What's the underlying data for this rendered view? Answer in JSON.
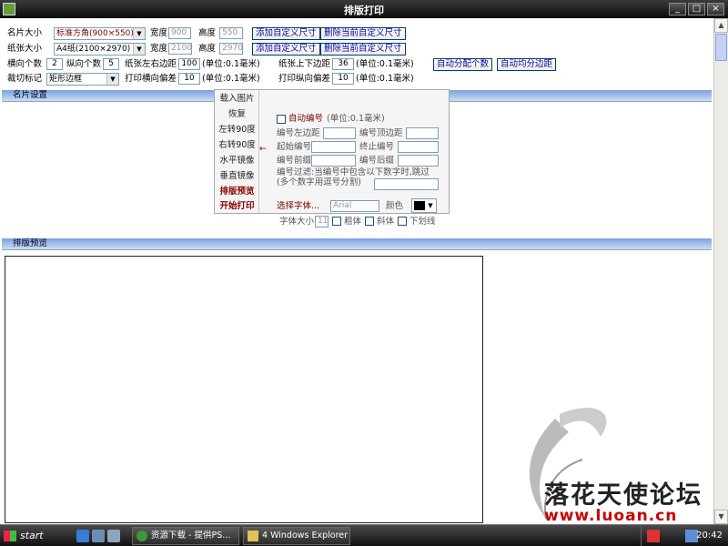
{
  "window": {
    "title": "排版打印",
    "min": "_",
    "max": "□",
    "close": "×"
  },
  "scroll": {
    "up": "▲",
    "down": "▼"
  },
  "row1": {
    "card_size_label": "名片大小",
    "card_size_value": "标准方角(900×550)",
    "width_label": "宽度",
    "width_value": "900",
    "height_label": "高度",
    "height_value": "550",
    "add_custom": "添加自定义尺寸",
    "remove_custom": "删除当前自定义尺寸"
  },
  "row2": {
    "paper_size_label": "纸张大小",
    "paper_size_value": "A4纸(2100×2970)",
    "width_label": "宽度",
    "width_value": "2100",
    "height_label": "高度",
    "height_value": "2970",
    "add_custom": "添加自定义尺寸",
    "remove_custom": "删除当前自定义尺寸"
  },
  "row3": {
    "h_count_label": "横向个数",
    "h_count_value": "2",
    "v_count_label": "纵向个数",
    "v_count_value": "5",
    "lr_margin_label": "纸张左右边距",
    "lr_margin_value": "100",
    "unit1": "(单位:0.1毫米)",
    "tb_margin_label": "纸张上下边距",
    "tb_margin_value": "36",
    "unit2": "(单位:0.1毫米)",
    "auto_count": "自动分配个数",
    "auto_margin": "自动均分边距"
  },
  "row4": {
    "crop_label": "裁切标记",
    "crop_value": "矩形边框",
    "h_offset_label": "打印横向偏差",
    "h_offset_value": "10",
    "unit1": "(单位:0.1毫米)",
    "v_offset_label": "打印纵向偏差",
    "v_offset_value": "10",
    "unit2": "(单位:0.1毫米)"
  },
  "sections": {
    "card_settings": "名片设置",
    "preview": "排版预览"
  },
  "menu": {
    "load_image": "载入图片",
    "restore": "恢复",
    "rotate_left": "左转90度",
    "rotate_right": "右转90度",
    "flip_h": "水平镜像",
    "flip_v": "垂直镜像",
    "layout_preview": "排版预览",
    "start_print": "开始打印",
    "arrow": "←"
  },
  "numbering": {
    "auto_label": "自动编号",
    "unit": "(单位:0.1毫米)",
    "left_margin_label": "编号左边距",
    "top_margin_label": "编号顶边距",
    "start_label": "起始编号",
    "end_label": "终止编号",
    "prefix_label": "编号前缀",
    "suffix_label": "编号后缀",
    "filter_line1": "编号过滤:当编号中包含以下数字时,跳过",
    "filter_line2": "(多个数字用逗号分割)"
  },
  "font": {
    "choose_label": "选择字体...",
    "font_value": "Arial",
    "color_label": "颜色",
    "size_label": "字体大小",
    "size_value": "11",
    "bold_label": "粗体",
    "italic_label": "斜体",
    "underline_label": "下划线"
  },
  "watermark": {
    "text_cn": "落花天使论坛",
    "url": "www.luoan.cn"
  },
  "taskbar": {
    "start": "start",
    "task1": "资源下载 - 提供PS...",
    "task2": "4 Windows Explorer",
    "clock": "20:42"
  }
}
